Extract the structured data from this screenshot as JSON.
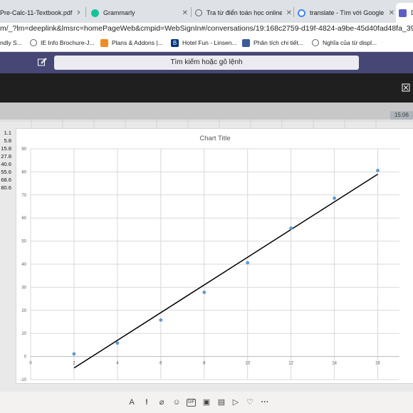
{
  "browser": {
    "tabs": [
      {
        "label": "Pre-Calc-11-Textbook.pdf",
        "icon": "pdf-icon"
      },
      {
        "label": "Grammarly",
        "icon": "grammarly-icon"
      },
      {
        "label": "Tra từ điển toán học online -",
        "icon": "globe-icon"
      },
      {
        "label": "translate - Tìm với Google",
        "icon": "google-icon"
      },
      {
        "label": "D",
        "icon": "teams-icon"
      }
    ],
    "address": "m/_?lm=deeplink&lmsrc=homePageWeb&cmpid=WebSignIn#/conversations/19:168c2759-d19f-4824-a9be-45d40fad48fa_39282682-7",
    "bookmarks": [
      {
        "label": "ndly S...",
        "icon": "bookmark-icon"
      },
      {
        "label": "IE Info Brochure-J...",
        "icon": "globe-icon"
      },
      {
        "label": "Plans & Addons |...",
        "icon": "plans-icon"
      },
      {
        "label": "Hotel Fun - Linsen...",
        "icon": "booking-icon"
      },
      {
        "label": "Phân tích chi tiết...",
        "icon": "grid-icon"
      },
      {
        "label": "Nghĩa của từ displ...",
        "icon": "globe-icon"
      }
    ]
  },
  "teams": {
    "search_placeholder": "Tìm kiếm hoặc gõ lệnh",
    "time": "15:06"
  },
  "sheet": {
    "column_values": [
      "1.1",
      "5.8",
      "15.8",
      "27.8",
      "40.6",
      "55.6",
      "68.6",
      "80.6"
    ]
  },
  "chart_data": {
    "type": "scatter",
    "title": "Chart Title",
    "x_ticks": [
      "0",
      "2",
      "4",
      "6",
      "8",
      "10",
      "12",
      "14",
      "16"
    ],
    "y_ticks": [
      "-10",
      "0",
      "10",
      "20",
      "30",
      "40",
      "50",
      "60",
      "70",
      "80",
      "90"
    ],
    "xlim": [
      0,
      17
    ],
    "ylim": [
      -10,
      90
    ],
    "grid": true,
    "x": [
      2,
      4,
      6,
      8,
      10,
      12,
      14,
      16
    ],
    "y": [
      1.1,
      5.8,
      15.8,
      27.8,
      40.6,
      55.6,
      68.6,
      80.6
    ],
    "trendline": {
      "type": "linear",
      "x": [
        2,
        16
      ],
      "y": [
        -5,
        79
      ]
    },
    "marker_color": "#5b9bd5",
    "trendline_color": "#000000"
  },
  "colors": {
    "teams_bar": "#464775",
    "dark_panel": "#1f1f1f"
  }
}
